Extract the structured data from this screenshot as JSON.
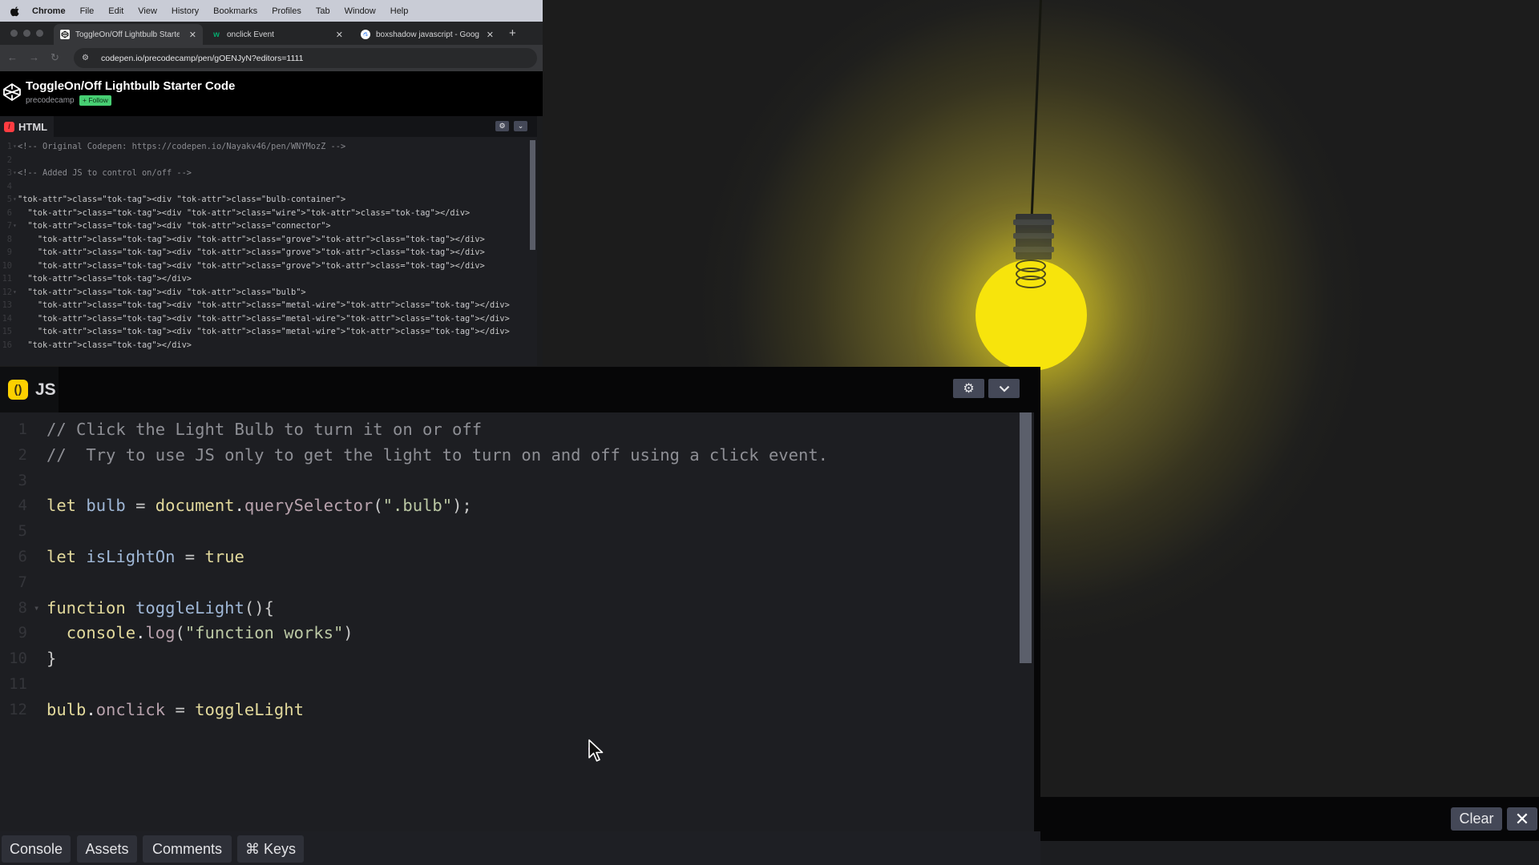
{
  "menubar": {
    "app_name": "Chrome",
    "items": [
      "File",
      "Edit",
      "View",
      "History",
      "Bookmarks",
      "Profiles",
      "Tab",
      "Window",
      "Help"
    ]
  },
  "browser": {
    "tabs": [
      {
        "title": "ToggleOn/Off Lightbulb Starte",
        "favicon": "codepen-icon",
        "active": true
      },
      {
        "title": "onclick Event",
        "favicon": "w3schools-icon",
        "active": false
      },
      {
        "title": "boxshadow javascript - Goog",
        "favicon": "google-icon",
        "active": false
      }
    ],
    "new_tab_label": "+",
    "url": "codepen.io/precodecamp/pen/gOENJyN?editors=1111"
  },
  "codepen": {
    "pen_title": "ToggleOn/Off Lightbulb Starter Code",
    "author": "precodecamp",
    "follow_label": "+ Follow",
    "html_editor": {
      "label": "HTML",
      "lines": [
        "<!-- Original Codepen: https://codepen.io/Nayakv46/pen/WNYMozZ -->",
        "",
        "<!-- Added JS to control on/off -->",
        "",
        "<div class=\"bulb-container\">",
        "  <div class=\"wire\"></div>",
        "  <div class=\"connector\">",
        "    <div class=\"grove\"></div>",
        "    <div class=\"grove\"></div>",
        "    <div class=\"grove\"></div>",
        "  </div>",
        "  <div class=\"bulb\">",
        "    <div class=\"metal-wire\"></div>",
        "    <div class=\"metal-wire\"></div>",
        "    <div class=\"metal-wire\"></div>",
        "  </div>"
      ],
      "fold_lines": [
        1,
        3,
        5,
        7,
        12
      ]
    },
    "js_editor": {
      "label": "JS",
      "lines": [
        "// Click the Light Bulb to turn it on or off",
        "//  Try to use JS only to get the light to turn on and off using a click event.",
        "",
        "let bulb = document.querySelector(\".bulb\");",
        "",
        "let isLightOn = true",
        "",
        "function toggleLight(){",
        "  console.log(\"function works\")",
        "}",
        "",
        "bulb.onclick = toggleLight"
      ],
      "fold_lines": [
        8
      ]
    },
    "footer": {
      "buttons": [
        "Console",
        "Assets",
        "Comments",
        "⌘ Keys"
      ]
    },
    "console": {
      "clear_label": "Clear",
      "close_label": "✕"
    }
  },
  "preview": {
    "bulb_state": "on",
    "bulb_color": "#f7e40c"
  }
}
